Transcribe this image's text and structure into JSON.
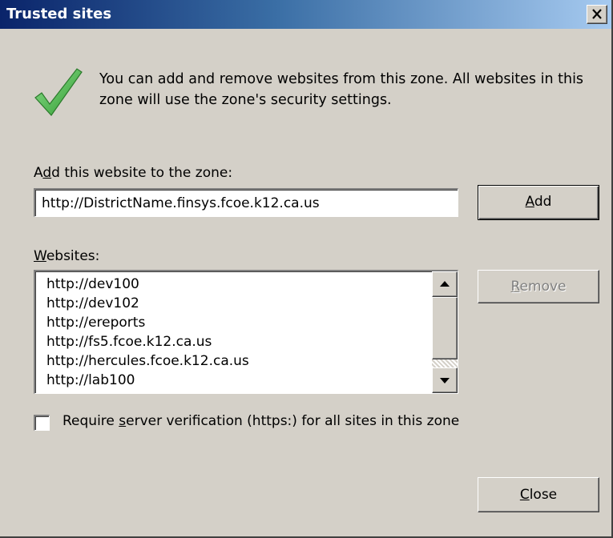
{
  "dialog": {
    "title": "Trusted sites",
    "close_glyph": "X",
    "check_icon": "green-checkmark-icon",
    "description": "You can add and remove websites from this zone. All websites in this zone will use the zone's security settings."
  },
  "add_section": {
    "label_pre": "A",
    "label_accel": "d",
    "label_post": "d this website to the zone:",
    "input_value": "http://DistrictName.finsys.fcoe.k12.ca.us",
    "add_accel": "A",
    "add_rest": "dd"
  },
  "websites": {
    "label_accel": "W",
    "label_rest": "ebsites:",
    "items": [
      "http://dev100",
      "http://dev102",
      "http://ereports",
      "http://fs5.fcoe.k12.ca.us",
      "http://hercules.fcoe.k12.ca.us",
      "http://lab100"
    ],
    "remove_accel": "R",
    "remove_rest": "emove",
    "remove_enabled": false
  },
  "verification": {
    "checked": false,
    "label_pre": "Require ",
    "label_accel": "s",
    "label_post": "erver verification (https:) for all sites in this zone"
  },
  "footer": {
    "close_accel": "C",
    "close_rest": "lose"
  },
  "colors": {
    "title_start": "#0a246a",
    "title_end": "#a6caf0",
    "face": "#d4d0c8",
    "check_green": "#3aa33a"
  }
}
